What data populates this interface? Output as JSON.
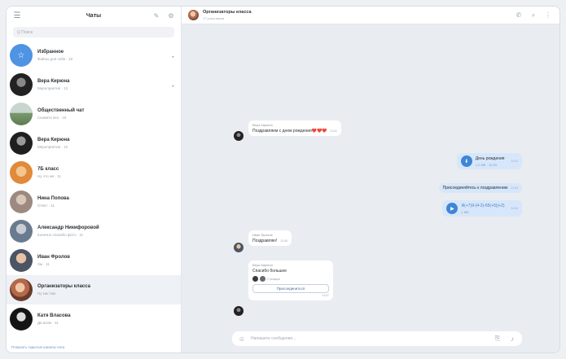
{
  "sidebar": {
    "title": "Чаты",
    "search_placeholder": "Q  Поиск",
    "chats": [
      {
        "name": "Избранное",
        "preview": "Файлы для себя · 10",
        "pinned": true,
        "avatar": "favorites"
      },
      {
        "name": "Вера Кирюна",
        "preview": "Мероприятия · 12",
        "pinned": true,
        "avatar": "dark"
      },
      {
        "name": "Общественный чат",
        "preview": "Скажите все · 10",
        "avatar": "landscape"
      },
      {
        "name": "Вера Кирюна",
        "preview": "Мероприятия · 12",
        "avatar": "dark"
      },
      {
        "name": "7Б класс",
        "preview": "Ну что же · 11",
        "avatar": "orange"
      },
      {
        "name": "Нина Попова",
        "preview": "Ответ · 11",
        "avatar": "grey"
      },
      {
        "name": "Александр Никифоровой",
        "preview": "Конечно спасибо фото · 11",
        "avatar": "bluegrey"
      },
      {
        "name": "Иван Фролов",
        "preview": "Хм · 11",
        "avatar": "man"
      },
      {
        "name": "Организаторы класса",
        "preview": "Ну как там",
        "avatar": "group",
        "active": true
      },
      {
        "name": "Катя Власова",
        "preview": "Да всем · 11",
        "avatar": "dark2"
      }
    ],
    "footer": "Показать скрытые каналы чата"
  },
  "conversation": {
    "title": "Организаторы класса",
    "status": "17 участников",
    "messages": {
      "m1_author": "Вера Кирюна",
      "m1_text": "Поздравляем с днем рождения❤️❤️❤️",
      "m1_time": "11:01",
      "m2_file": "День рождения",
      "m2_size": "1.2 МБ · 12.03",
      "m2_time": "11:02",
      "m3_text": "Присоединяйтесь к поздравлению",
      "m3_time": "11:03",
      "m4_file": "Ф(+7)9-(4-2)-65(+5)(+2)",
      "m4_size": "1 МБ",
      "m4_time": "11:04",
      "m5_author": "Иван Фролов",
      "m5_text": "Поздравляю!",
      "m5_time": "11:05",
      "m6_author": "Вера Кирюна",
      "m6_text": "Спасибо большое",
      "m6_count": "2 реакции",
      "m6_button": "Присоединиться",
      "m6_time": "11:07"
    },
    "composer_placeholder": "Напишите сообщение..."
  },
  "colors": {
    "accent": "#3e86d6",
    "outgoing": "#d7e7fb",
    "background": "#e9ecf0"
  }
}
